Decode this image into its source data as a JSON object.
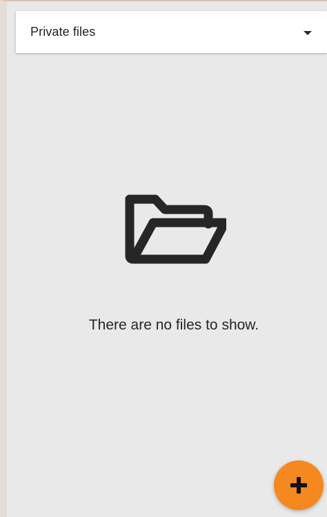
{
  "file_selector": {
    "label": "Private files",
    "icon": "caret-down-icon"
  },
  "empty_state": {
    "icon": "folder-open-icon",
    "message": "There are no files to show."
  },
  "fab": {
    "icon": "plus-icon",
    "color": "#f5881f"
  },
  "colors": {
    "background": "#e9e9e9",
    "card": "#ffffff",
    "text": "#252525",
    "accent": "#f5881f"
  }
}
